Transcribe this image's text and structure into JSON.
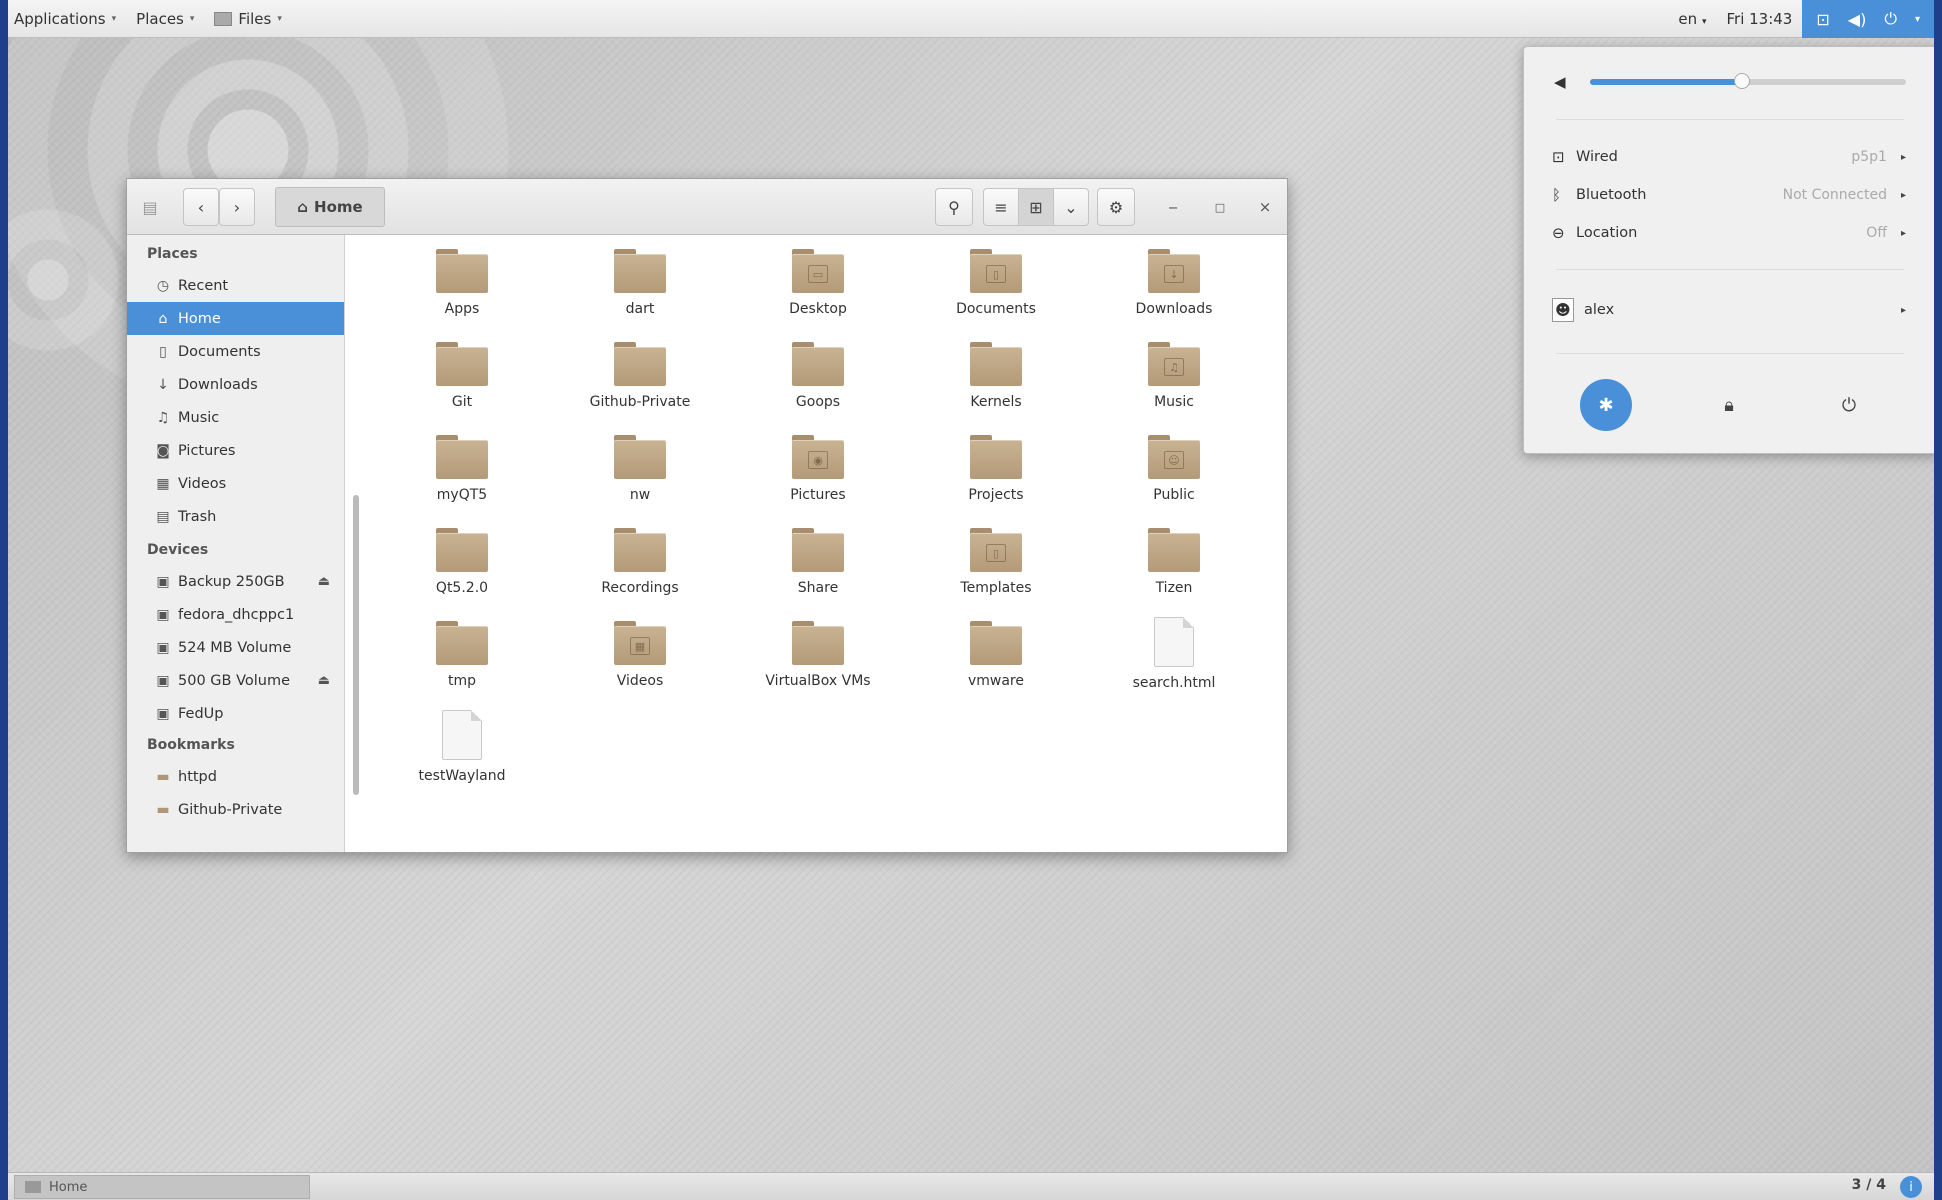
{
  "topbar": {
    "applications_label": "Applications",
    "places_label": "Places",
    "files_label": "Files",
    "language": "en",
    "clock": "Fri 13:43"
  },
  "window": {
    "breadcrumb_label": "Home",
    "sidebar": {
      "places_heading": "Places",
      "places": [
        {
          "label": "Recent",
          "icon": "clock-icon"
        },
        {
          "label": "Home",
          "icon": "home-icon",
          "active": true
        },
        {
          "label": "Documents",
          "icon": "document-icon"
        },
        {
          "label": "Downloads",
          "icon": "download-icon"
        },
        {
          "label": "Music",
          "icon": "music-icon"
        },
        {
          "label": "Pictures",
          "icon": "camera-icon"
        },
        {
          "label": "Videos",
          "icon": "film-icon"
        },
        {
          "label": "Trash",
          "icon": "trash-icon"
        }
      ],
      "devices_heading": "Devices",
      "devices": [
        {
          "label": "Backup 250GB",
          "icon": "drive-icon",
          "eject": true
        },
        {
          "label": "fedora_dhcppc1",
          "icon": "drive-icon",
          "eject": false
        },
        {
          "label": "524 MB Volume",
          "icon": "drive-icon",
          "eject": false
        },
        {
          "label": "500 GB Volume",
          "icon": "drive-icon",
          "eject": true
        },
        {
          "label": "FedUp",
          "icon": "drive-icon",
          "eject": false
        }
      ],
      "bookmarks_heading": "Bookmarks",
      "bookmarks": [
        {
          "label": "httpd",
          "icon": "folder-icon"
        },
        {
          "label": "Github-Private",
          "icon": "folder-icon"
        }
      ]
    },
    "files": [
      {
        "name": "Apps",
        "kind": "folder",
        "emblem": ""
      },
      {
        "name": "dart",
        "kind": "folder",
        "emblem": ""
      },
      {
        "name": "Desktop",
        "kind": "folder",
        "emblem": "▭"
      },
      {
        "name": "Documents",
        "kind": "folder",
        "emblem": "▯"
      },
      {
        "name": "Downloads",
        "kind": "folder",
        "emblem": "↓"
      },
      {
        "name": "Git",
        "kind": "folder",
        "emblem": ""
      },
      {
        "name": "Github-Private",
        "kind": "folder",
        "emblem": ""
      },
      {
        "name": "Goops",
        "kind": "folder",
        "emblem": ""
      },
      {
        "name": "Kernels",
        "kind": "folder",
        "emblem": ""
      },
      {
        "name": "Music",
        "kind": "folder",
        "emblem": "♫"
      },
      {
        "name": "myQT5",
        "kind": "folder",
        "emblem": ""
      },
      {
        "name": "nw",
        "kind": "folder",
        "emblem": ""
      },
      {
        "name": "Pictures",
        "kind": "folder",
        "emblem": "◉"
      },
      {
        "name": "Projects",
        "kind": "folder",
        "emblem": ""
      },
      {
        "name": "Public",
        "kind": "folder",
        "emblem": "☺"
      },
      {
        "name": "Qt5.2.0",
        "kind": "folder",
        "emblem": ""
      },
      {
        "name": "Recordings",
        "kind": "folder",
        "emblem": ""
      },
      {
        "name": "Share",
        "kind": "folder",
        "emblem": ""
      },
      {
        "name": "Templates",
        "kind": "folder",
        "emblem": "▯"
      },
      {
        "name": "Tizen",
        "kind": "folder",
        "emblem": ""
      },
      {
        "name": "tmp",
        "kind": "folder",
        "emblem": ""
      },
      {
        "name": "Videos",
        "kind": "folder",
        "emblem": "▦"
      },
      {
        "name": "VirtualBox VMs",
        "kind": "folder",
        "emblem": ""
      },
      {
        "name": "vmware",
        "kind": "folder",
        "emblem": ""
      },
      {
        "name": "search.html",
        "kind": "file",
        "emblem": ""
      },
      {
        "name": "testWayland",
        "kind": "file",
        "emblem": ""
      }
    ]
  },
  "system_menu": {
    "volume_level": 0.48,
    "wired_label": "Wired",
    "wired_value": "p5p1",
    "bluetooth_label": "Bluetooth",
    "bluetooth_value": "Not Connected",
    "location_label": "Location",
    "location_value": "Off",
    "user_label": "alex"
  },
  "bottombar": {
    "task_label": "Home",
    "workspace": "3 / 4"
  },
  "colors": {
    "accent": "#4a90d9",
    "folder": "#bba382",
    "frame": "#1f3f8a"
  }
}
